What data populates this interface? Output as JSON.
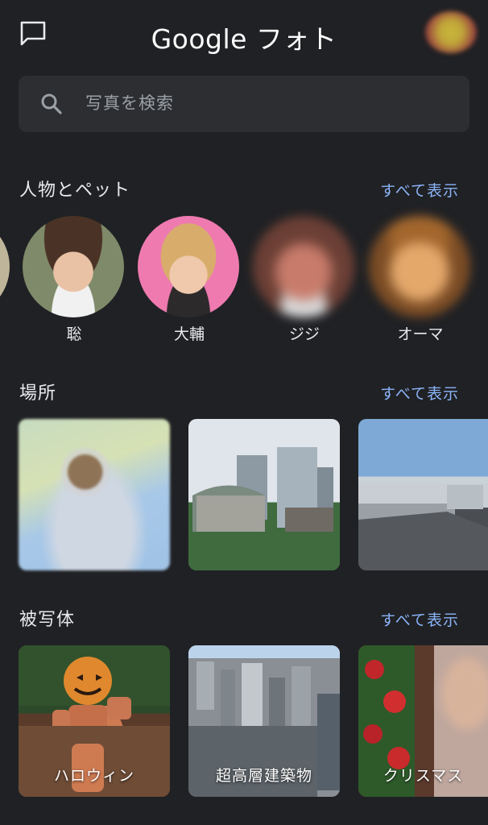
{
  "header": {
    "title": "Google フォト"
  },
  "search": {
    "placeholder": "写真を検索"
  },
  "people_section": {
    "title": "人物とペット",
    "view_all": "すべて表示",
    "people": [
      {
        "name": "聡"
      },
      {
        "name": "大輔"
      },
      {
        "name": "ジジ"
      },
      {
        "name": "オーマ"
      }
    ]
  },
  "places_section": {
    "title": "場所",
    "view_all": "すべて表示"
  },
  "subjects_section": {
    "title": "被写体",
    "view_all": "すべて表示",
    "items": [
      {
        "label": "ハロウィン"
      },
      {
        "label": "超高層建築物"
      },
      {
        "label": "クリスマス"
      }
    ]
  },
  "colors": {
    "background": "#202124",
    "search_bg": "#2d2e31",
    "accent": "#8ab4f8",
    "text": "#e8eaed"
  }
}
